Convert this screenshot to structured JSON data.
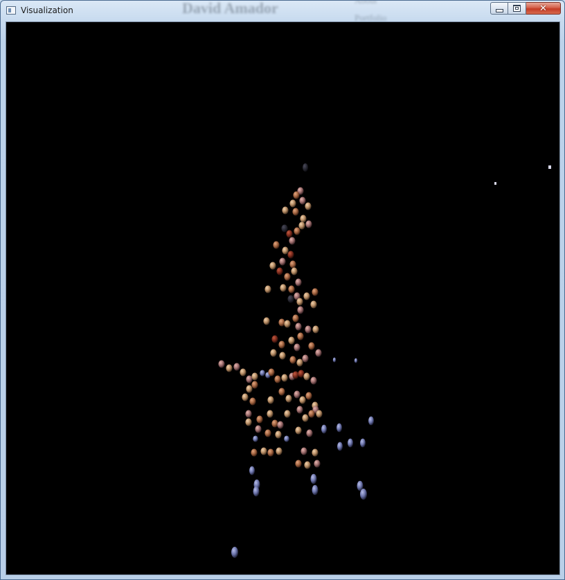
{
  "window": {
    "title": "Visualization",
    "behind_title_text": [
      "David Amador",
      "About",
      "Portfolio"
    ],
    "icons": {
      "app": "app-window-icon",
      "minimize": "minimize-icon",
      "maximize": "maximize-icon",
      "close": "close-icon"
    }
  },
  "scene": {
    "background": "#000000",
    "colors": {
      "warm_light": "#c9a27a",
      "warm_mid": "#b7785a",
      "warm_dark": "#8a3a2a",
      "rose": "#b88080",
      "blue_grey": "#7e86b8"
    }
  }
}
